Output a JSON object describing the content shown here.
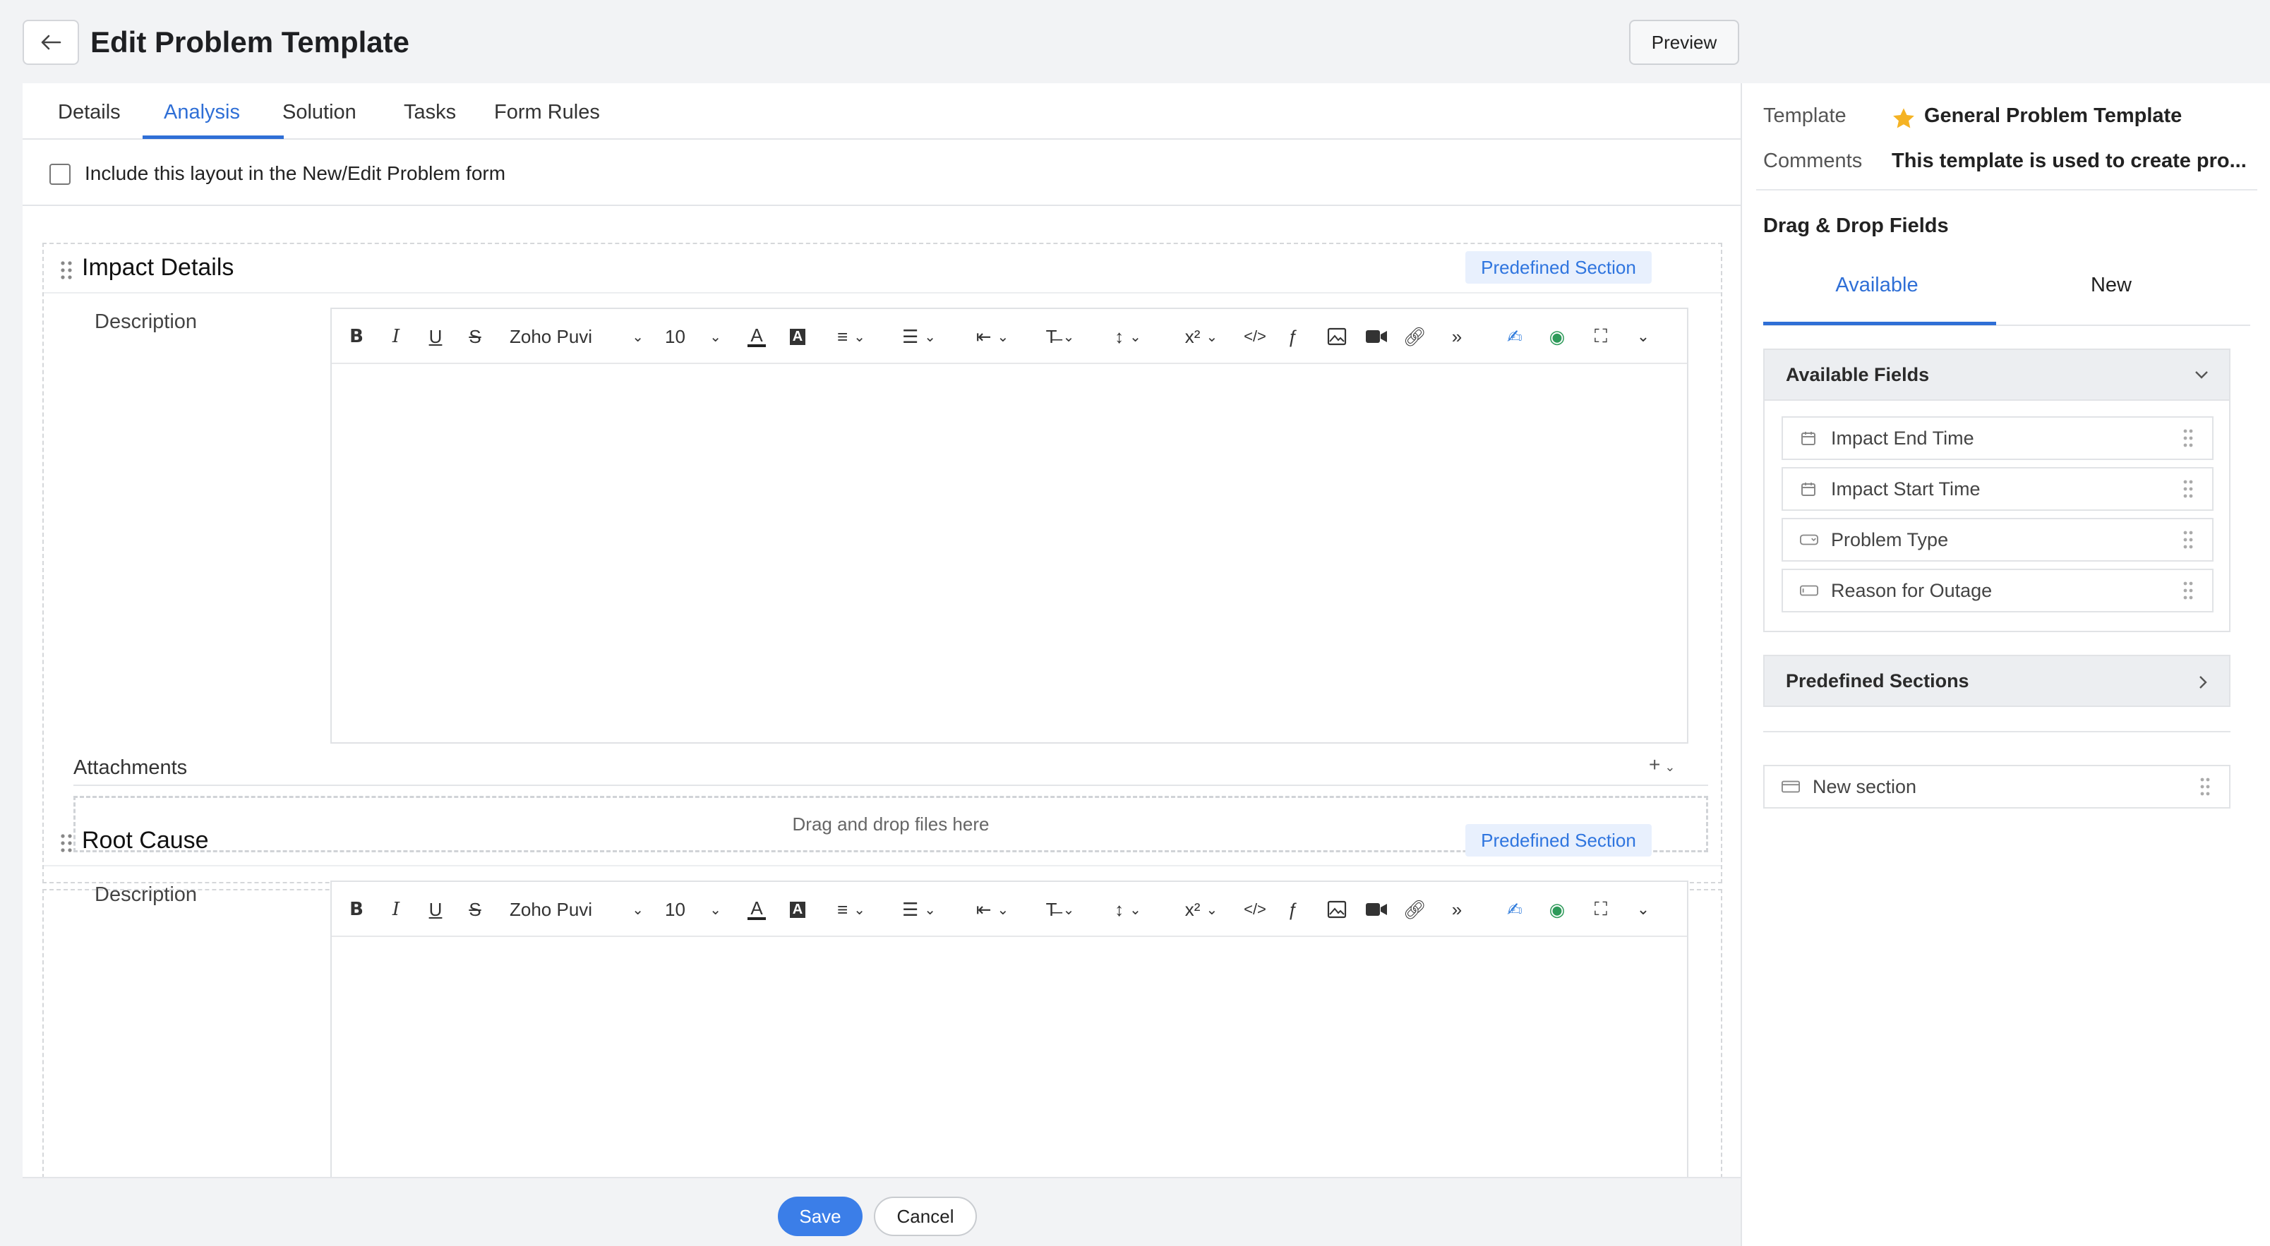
{
  "header": {
    "title": "Edit Problem Template",
    "preview_label": "Preview"
  },
  "tabs": [
    {
      "label": "Details"
    },
    {
      "label": "Analysis",
      "active": true
    },
    {
      "label": "Solution"
    },
    {
      "label": "Tasks"
    },
    {
      "label": "Form Rules"
    }
  ],
  "include_layout": {
    "label": "Include this layout in the New/Edit Problem form",
    "checked": false
  },
  "sections": [
    {
      "title": "Impact Details",
      "badge": "Predefined Section",
      "description_label": "Description",
      "attachments_label": "Attachments",
      "drop_text": "Drag and drop files here"
    },
    {
      "title": "Root Cause",
      "badge": "Predefined Section",
      "description_label": "Description"
    }
  ],
  "editor": {
    "font_name": "Zoho Puvi",
    "font_size": "10"
  },
  "footer": {
    "save_label": "Save",
    "cancel_label": "Cancel"
  },
  "sidebar": {
    "template_label": "Template",
    "template_value": "General Problem Template",
    "comments_label": "Comments",
    "comments_value": "This template is used to create pro...",
    "drag_drop_title": "Drag & Drop Fields",
    "tabs": [
      {
        "label": "Available",
        "active": true
      },
      {
        "label": "New"
      }
    ],
    "available_fields_title": "Available Fields",
    "fields": [
      {
        "label": "Impact End Time",
        "icon": "calendar-icon"
      },
      {
        "label": "Impact Start Time",
        "icon": "calendar-icon"
      },
      {
        "label": "Problem Type",
        "icon": "dropdown-field-icon"
      },
      {
        "label": "Reason for Outage",
        "icon": "text-field-icon"
      }
    ],
    "predefined_sections_title": "Predefined Sections",
    "new_section_label": "New section"
  },
  "colors": {
    "accent": "#2f6fd6",
    "badge_bg": "#e8f0fd",
    "badge_text": "#2f75df",
    "save_bg": "#3b7ee8",
    "star": "#f5b324"
  }
}
